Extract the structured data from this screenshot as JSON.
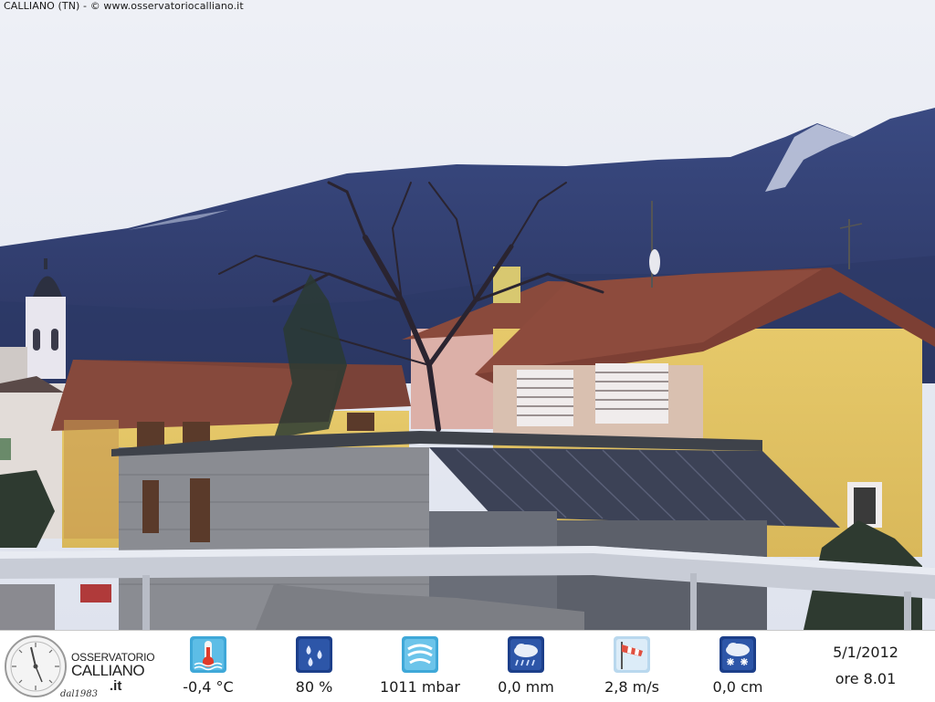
{
  "caption": "CALLIANO (TN) - © www.osservatoriocalliano.it",
  "logo": {
    "line1": "OSSERVATORIO",
    "line2": "CALLIANO",
    "line3": ".it",
    "line4": "dal1983"
  },
  "stats": [
    {
      "name": "temperature",
      "icon": "thermometer-icon",
      "value": "-0,4 °C"
    },
    {
      "name": "humidity",
      "icon": "water-drops-icon",
      "value": "80 %"
    },
    {
      "name": "pressure",
      "icon": "pressure-wind-icon",
      "value": "1011 mbar"
    },
    {
      "name": "rain",
      "icon": "rain-cloud-icon",
      "value": "0,0 mm"
    },
    {
      "name": "wind",
      "icon": "windsock-icon",
      "value": "2,8 m/s"
    },
    {
      "name": "snow",
      "icon": "snow-cloud-icon",
      "value": "0,0 cm"
    }
  ],
  "date": "5/1/2012",
  "time": "ore 8.01"
}
